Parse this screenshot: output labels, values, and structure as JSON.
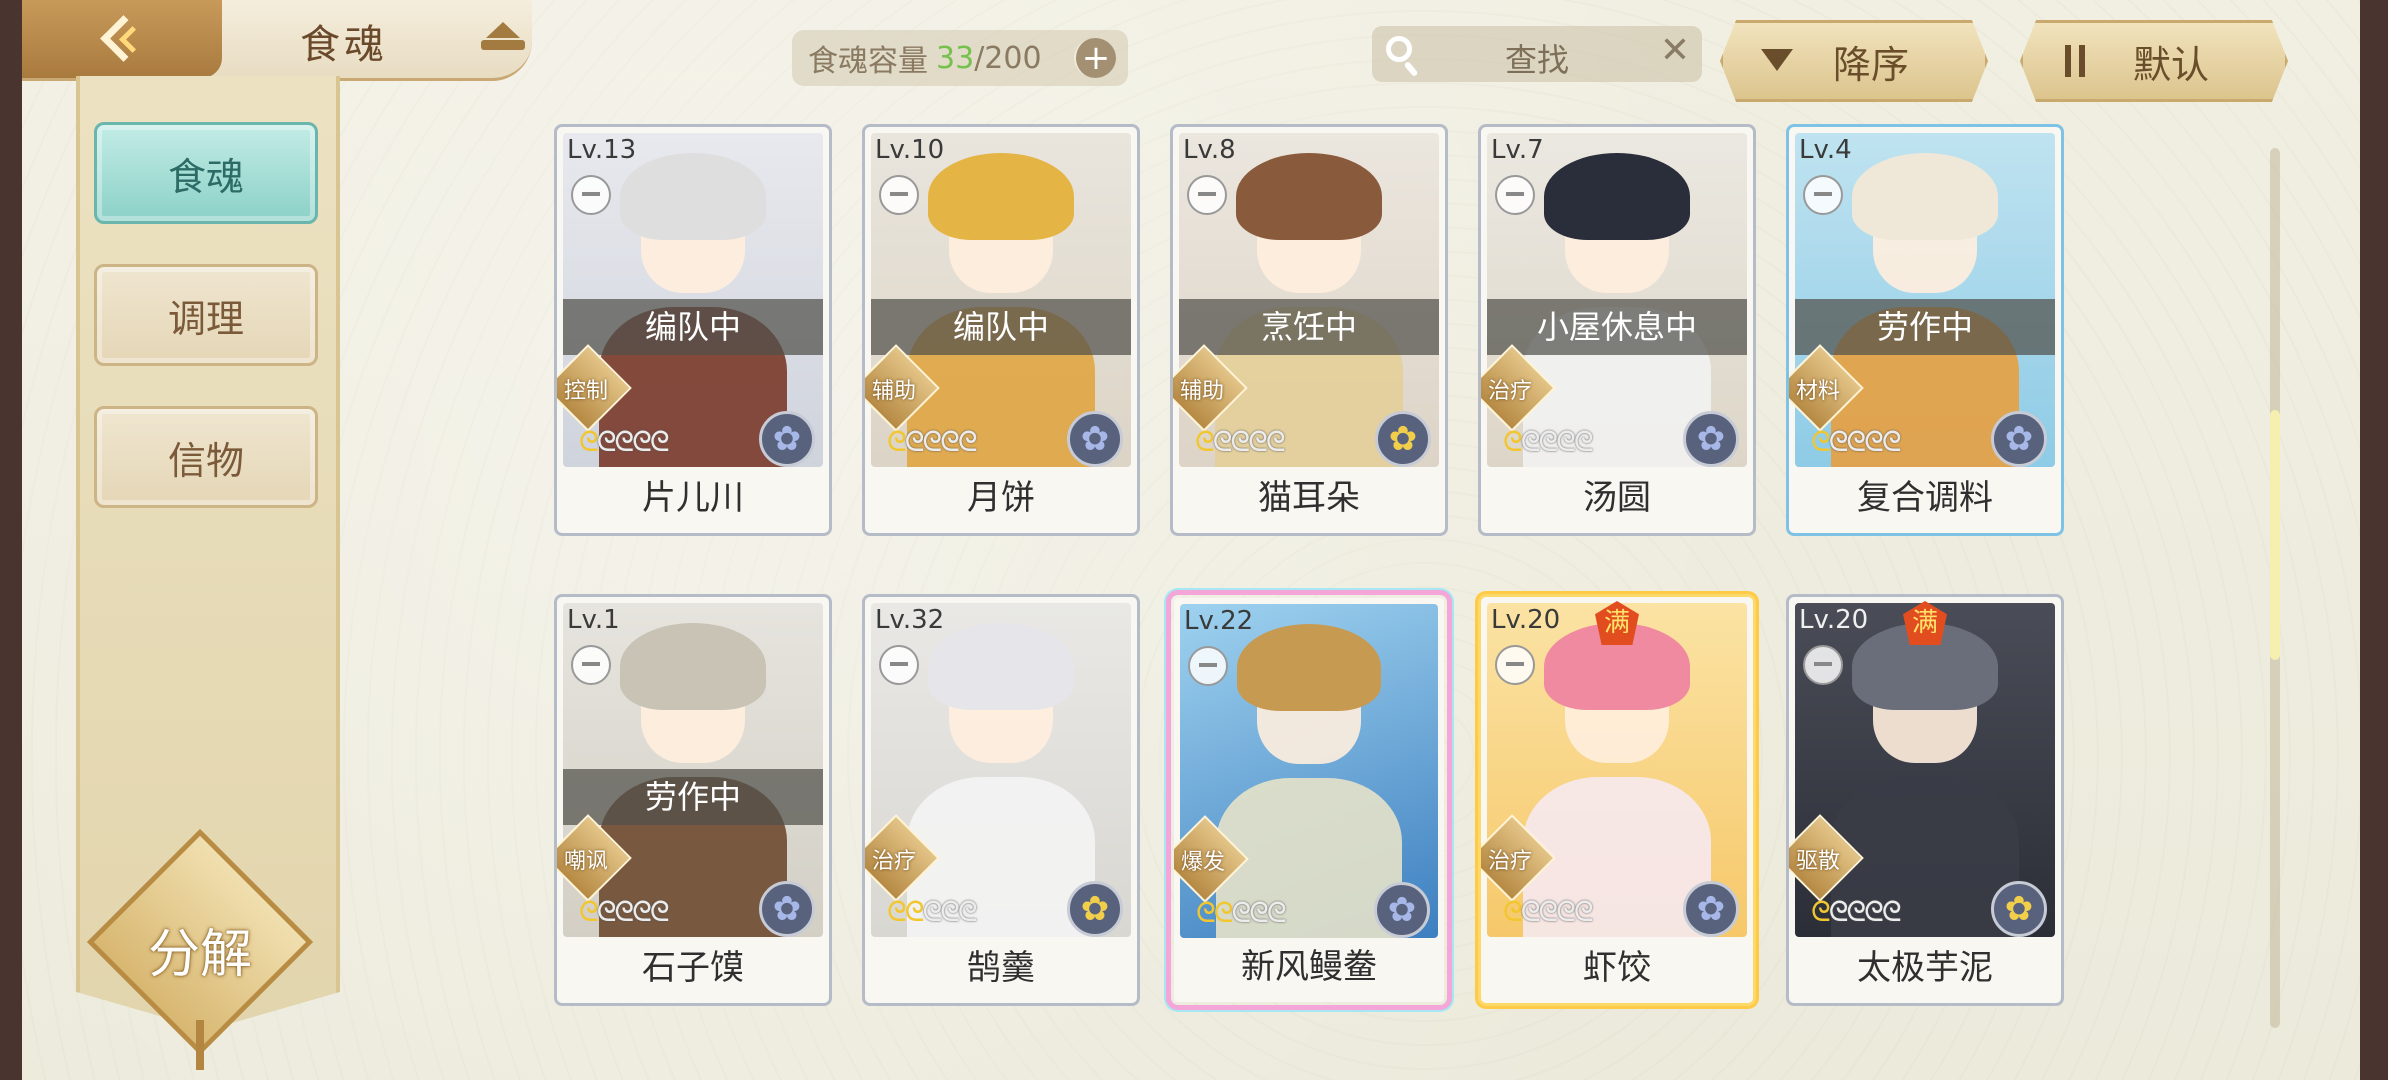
{
  "header": {
    "title": "食魂",
    "capacity_label": "食魂容量",
    "capacity_current": "33",
    "capacity_max": "/200",
    "plus": "+",
    "search_placeholder": "查找",
    "clear": "✕",
    "sort_desc_label": "降序",
    "sort_default_label": "默认"
  },
  "sidebar": {
    "items": [
      {
        "label": "食魂",
        "active": true
      },
      {
        "label": "调理",
        "active": false
      },
      {
        "label": "信物",
        "active": false
      }
    ],
    "decompose_label": "分解"
  },
  "cards": [
    {
      "level": "Lv.13",
      "status": "编队中",
      "role": "控制",
      "stars": 1,
      "name": "片儿川",
      "flower": "blue"
    },
    {
      "level": "Lv.10",
      "status": "编队中",
      "role": "辅助",
      "stars": 1,
      "name": "月饼",
      "flower": "blue"
    },
    {
      "level": "Lv.8",
      "status": "烹饪中",
      "role": "辅助",
      "stars": 1,
      "name": "猫耳朵",
      "flower": "gold"
    },
    {
      "level": "Lv.7",
      "status": "小屋休息中",
      "role": "治疗",
      "stars": 1,
      "name": "汤圆",
      "flower": "blue"
    },
    {
      "level": "Lv.4",
      "status": "劳作中",
      "role": "材料",
      "stars": 1,
      "name": "复合调料",
      "flower": "blue"
    },
    {
      "level": "Lv.1",
      "status": "劳作中",
      "role": "嘲讽",
      "stars": 1,
      "name": "石子馍",
      "flower": "blue"
    },
    {
      "level": "Lv.32",
      "status": "",
      "role": "治疗",
      "stars": 2,
      "name": "鹄羹",
      "flower": "gold"
    },
    {
      "level": "Lv.22",
      "status": "",
      "role": "爆发",
      "stars": 2,
      "name": "新风鳗鲞",
      "flower": "blue"
    },
    {
      "level": "Lv.20",
      "status": "",
      "role": "治疗",
      "stars": 1,
      "name": "虾饺",
      "flower": "blue",
      "full_badge": "满"
    },
    {
      "level": "Lv.20",
      "status": "",
      "role": "驱散",
      "stars": 1,
      "name": "太极芋泥",
      "flower": "gold",
      "full_badge": "满"
    }
  ],
  "star_glyph": "ᘓ"
}
